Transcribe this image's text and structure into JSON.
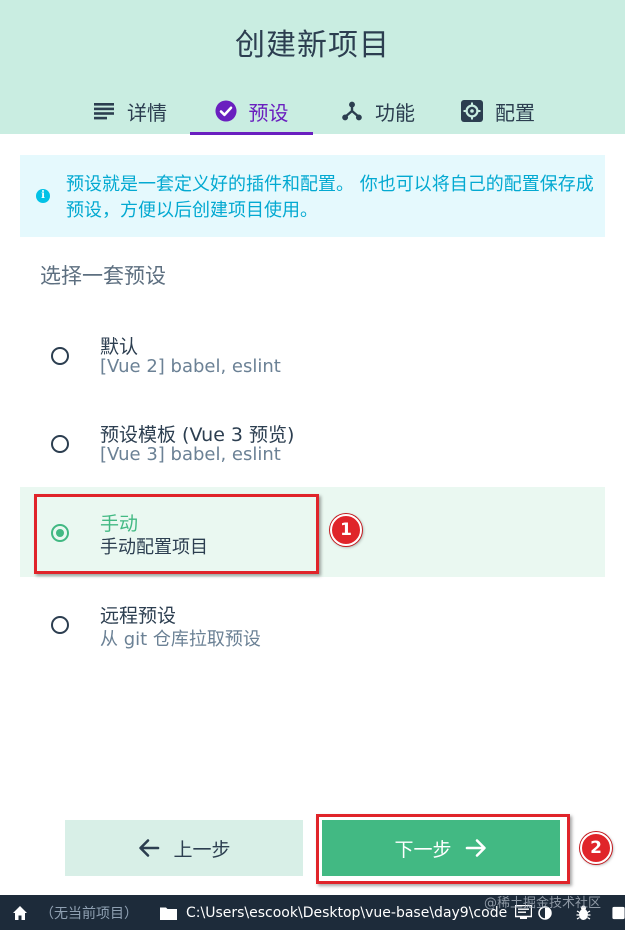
{
  "header": {
    "title": "创建新项目",
    "tabs": [
      {
        "label": "详情",
        "icon": "list-icon",
        "active": false
      },
      {
        "label": "预设",
        "icon": "check-circle-icon",
        "active": true
      },
      {
        "label": "功能",
        "icon": "branch-icon",
        "active": false
      },
      {
        "label": "配置",
        "icon": "gear-icon",
        "active": false
      }
    ]
  },
  "info": {
    "text": "预设就是一套定义好的插件和配置。 你也可以将自己的配置保存成预设，方便以后创建项目使用。",
    "icon_glyph": "i"
  },
  "presets": {
    "title": "选择一套预设",
    "options": [
      {
        "name": "默认",
        "desc": "[Vue 2] babel, eslint",
        "selected": false
      },
      {
        "name": "预设模板 (Vue 3 预览)",
        "desc": "[Vue 3] babel, eslint",
        "selected": false
      },
      {
        "name": "手动",
        "desc": "手动配置项目",
        "selected": true
      },
      {
        "name": "远程预设",
        "desc": "从 git 仓库拉取预设",
        "selected": false
      }
    ]
  },
  "annotations": {
    "badge1": "1",
    "badge2": "2"
  },
  "footer": {
    "prev_label": "上一步",
    "next_label": "下一步"
  },
  "statusbar": {
    "project": "（无当前项目）",
    "path": "C:\\Users\\escook\\Desktop\\vue-base\\day9\\code"
  },
  "watermark": "@稀土掘金技术社区",
  "colors": {
    "header_bg": "#c9ede1",
    "accent_purple": "#6a1fbf",
    "accent_green": "#42b983",
    "info_bg": "#e5f9fd",
    "info_text": "#03a9d1",
    "annotation_red": "#e0242a",
    "statusbar_bg": "#1d2b3a"
  }
}
